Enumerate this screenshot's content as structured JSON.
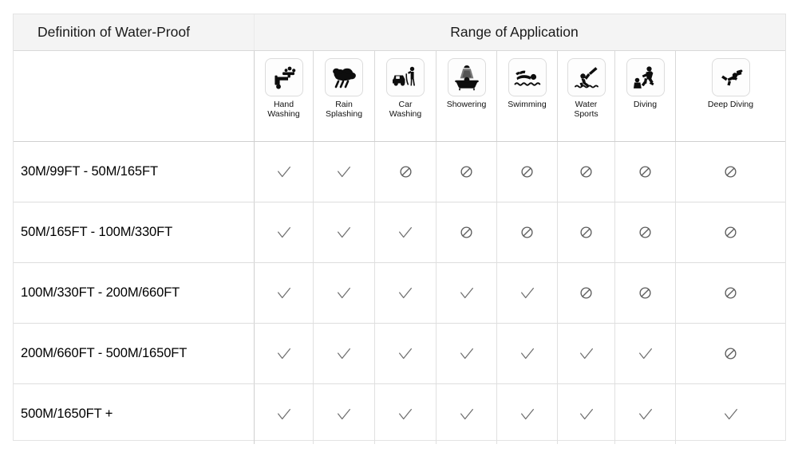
{
  "header": {
    "definition_title": "Definition of Water-Proof",
    "range_title": "Range of Application"
  },
  "columns": [
    {
      "id": "hand-washing",
      "label_line1": "Hand",
      "label_line2": "Washing",
      "icon": "faucet-icon"
    },
    {
      "id": "rain-splashing",
      "label_line1": "Rain",
      "label_line2": "Splashing",
      "icon": "rain-cloud-icon"
    },
    {
      "id": "car-washing",
      "label_line1": "Car",
      "label_line2": "Washing",
      "icon": "car-washing-icon"
    },
    {
      "id": "showering",
      "label_line1": "Showering",
      "label_line2": "",
      "icon": "shower-bath-icon"
    },
    {
      "id": "swimming",
      "label_line1": "Swimming",
      "label_line2": "",
      "icon": "swimmer-icon"
    },
    {
      "id": "water-sports",
      "label_line1": "Water",
      "label_line2": "Sports",
      "icon": "water-ski-icon"
    },
    {
      "id": "diving",
      "label_line1": "Diving",
      "label_line2": "",
      "icon": "diver-jump-icon"
    },
    {
      "id": "deep-diving",
      "label_line1": "Deep Diving",
      "label_line2": "",
      "icon": "scuba-diver-icon"
    }
  ],
  "rows": [
    {
      "id": "30m-50m",
      "label": "30M/99FT  -  50M/165FT",
      "marks": [
        "check",
        "check",
        "deny",
        "deny",
        "deny",
        "deny",
        "deny",
        "deny"
      ]
    },
    {
      "id": "50m-100m",
      "label": "50M/165FT  -  100M/330FT",
      "marks": [
        "check",
        "check",
        "check",
        "deny",
        "deny",
        "deny",
        "deny",
        "deny"
      ]
    },
    {
      "id": "100m-200m",
      "label": "100M/330FT  -  200M/660FT",
      "marks": [
        "check",
        "check",
        "check",
        "check",
        "check",
        "deny",
        "deny",
        "deny"
      ]
    },
    {
      "id": "200m-500m",
      "label": "200M/660FT  -  500M/1650FT",
      "marks": [
        "check",
        "check",
        "check",
        "check",
        "check",
        "check",
        "check",
        "deny"
      ]
    },
    {
      "id": "500m-plus",
      "label": "500M/1650FT  +",
      "marks": [
        "check",
        "check",
        "check",
        "check",
        "check",
        "check",
        "check",
        "check"
      ]
    }
  ],
  "colors": {
    "header_background": "#f4f4f4",
    "border": "#dedede",
    "text": "#111111",
    "mark": "#6e6e6e",
    "icon": "#0d0d0d"
  }
}
